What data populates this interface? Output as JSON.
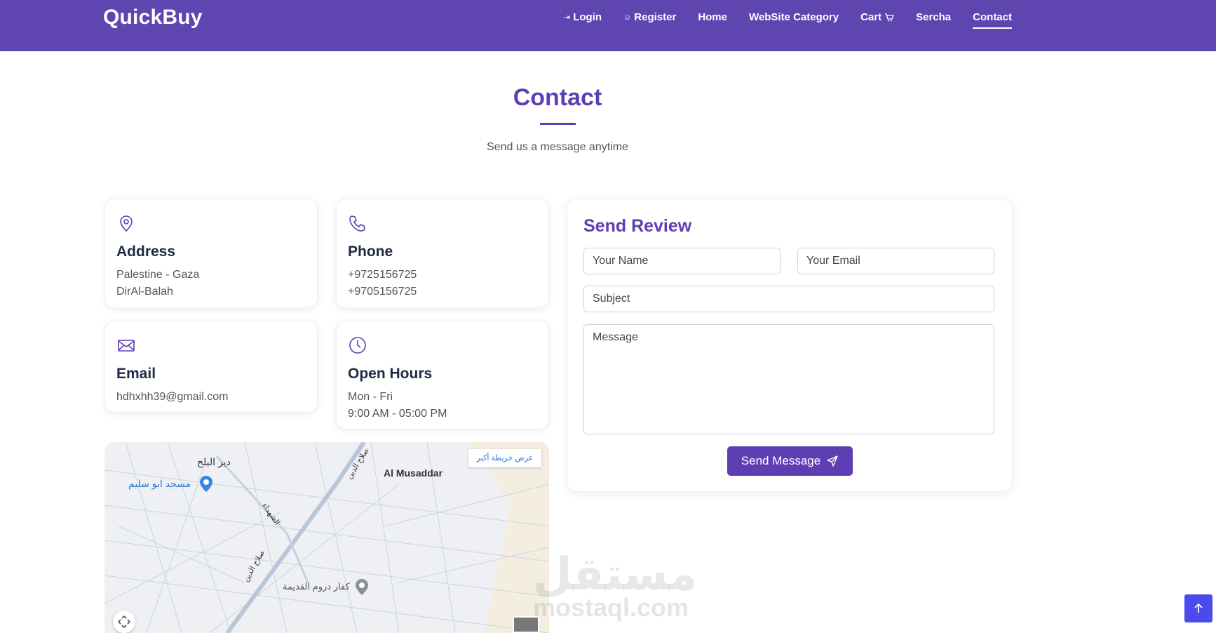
{
  "header": {
    "brand": "QuickBuy",
    "nav": [
      {
        "label": "Login",
        "icon": "login-icon"
      },
      {
        "label": "Register",
        "icon": "register-icon"
      },
      {
        "label": "Home"
      },
      {
        "label": "WebSite Category"
      },
      {
        "label": "Cart",
        "icon": "cart-icon"
      },
      {
        "label": "Sercha"
      },
      {
        "label": "Contact",
        "active": true
      }
    ]
  },
  "main": {
    "title": "Contact",
    "subtitle": "Send us a message anytime"
  },
  "cards": {
    "address": {
      "title": "Address",
      "line1": "Palestine - Gaza",
      "line2": "DirAl-Balah",
      "icon": "location-pin-icon"
    },
    "phone": {
      "title": "Phone",
      "line1": "+9725156725",
      "line2": "+9705156725",
      "icon": "phone-icon"
    },
    "email": {
      "title": "Email",
      "line1": "hdhxhh39@gmail.com",
      "icon": "envelope-icon"
    },
    "hours": {
      "title": "Open Hours",
      "line1": "Mon - Fri",
      "line2": "9:00 AM - 05:00 PM",
      "icon": "clock-icon"
    }
  },
  "map": {
    "view_larger": "عرض خريطة أكبر",
    "labels": {
      "deir": "دير البلح",
      "mosque": "مسجد ابو سليم",
      "musaddar": "Al Musaddar",
      "street1": "صلاح الدين",
      "street2": "الشهداء",
      "street3": "صلاح الدين",
      "kfar": "كفار دروم القديمة"
    }
  },
  "form": {
    "title": "Send Review",
    "name_placeholder": "Your Name",
    "email_placeholder": "Your Email",
    "subject_placeholder": "Subject",
    "message_placeholder": "Message",
    "submit_label": "Send Message"
  },
  "watermark": {
    "arabic": "مستقل",
    "latin": "mostaql.com"
  },
  "colors": {
    "navbar": "#5e45b0",
    "accent": "#5e3fb3",
    "scroll_top": "#4a4aef"
  }
}
